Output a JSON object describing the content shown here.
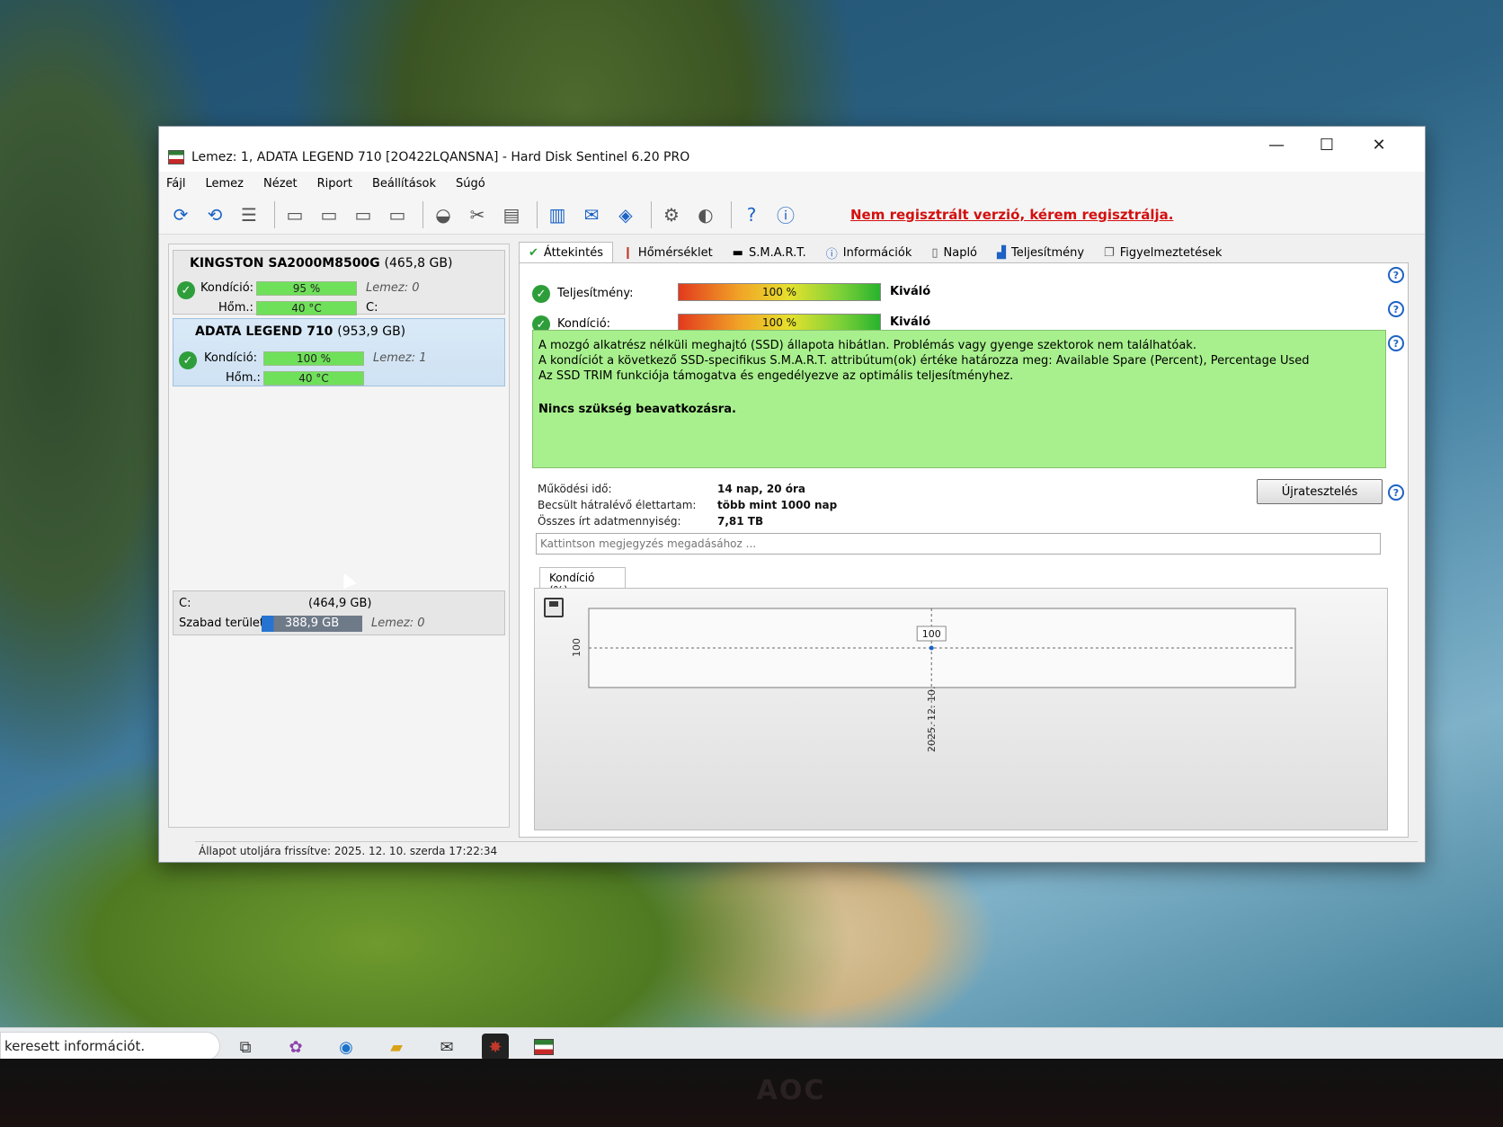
{
  "window": {
    "title": "Lemez: 1, ADATA LEGEND 710 [2O422LQANSNA]  -  Hard Disk Sentinel 6.20 PRO",
    "controls": {
      "minimize": "—",
      "maximize": "☐",
      "close": "✕"
    }
  },
  "menu": [
    "Fájl",
    "Lemez",
    "Nézet",
    "Riport",
    "Beállítások",
    "Súgó"
  ],
  "toolbar": {
    "registration_notice": "Nem regisztrált verzió, kérem regisztrálja."
  },
  "disks": [
    {
      "name": "KINGSTON SA2000M8500G",
      "size": "(465,8 GB)",
      "condition_label": "Kondíció:",
      "condition": "95 %",
      "condition_value": 95,
      "temp_label": "Hőm.:",
      "temp": "40 °C",
      "disk_ref": "Lemez: 0",
      "drive_letter": "C:"
    },
    {
      "name": "ADATA LEGEND 710",
      "size": "(953,9 GB)",
      "condition_label": "Kondíció:",
      "condition": "100 %",
      "condition_value": 100,
      "temp_label": "Hőm.:",
      "temp": "40 °C",
      "disk_ref": "Lemez: 1"
    }
  ],
  "volume": {
    "letter": "C:",
    "size": "(464,9 GB)",
    "free_label": "Szabad terület",
    "free": "388,9 GB",
    "disk_ref": "Lemez: 0"
  },
  "tabs": [
    {
      "label": "Áttekintés",
      "icon": "check-icon"
    },
    {
      "label": "Hőmérséklet",
      "icon": "thermometer-icon"
    },
    {
      "label": "S.M.A.R.T.",
      "icon": "smart-icon"
    },
    {
      "label": "Információk",
      "icon": "info-icon"
    },
    {
      "label": "Napló",
      "icon": "log-icon"
    },
    {
      "label": "Teljesítmény",
      "icon": "performance-icon"
    },
    {
      "label": "Figyelmeztetések",
      "icon": "alerts-icon"
    }
  ],
  "overview": {
    "performance_label": "Teljesítmény:",
    "performance": "100 %",
    "performance_rating": "Kiváló",
    "condition_label": "Kondíció:",
    "condition": "100 %",
    "condition_rating": "Kiváló",
    "status_lines": [
      "A mozgó alkatrész nélküli meghajtó (SSD) állapota hibátlan. Problémás vagy gyenge szektorok nem találhatóak.",
      "A kondíciót a következő SSD-specifikus S.M.A.R.T. attribútum(ok) értéke határozza meg:  Available Spare (Percent), Percentage Used",
      "Az SSD TRIM funkciója támogatva és engedélyezve az optimális teljesítményhez."
    ],
    "status_action": "Nincs szükség beavatkozásra.",
    "uptime_label": "Működési idő:",
    "uptime": "14 nap, 20 óra",
    "lifetime_label": "Becsült hátralévő élettartam:",
    "lifetime": "több mint 1000 nap",
    "written_label": "Összes írt adatmennyiség:",
    "written": "7,81 TB",
    "retest_button": "Újratesztelés",
    "note_placeholder": "Kattintson megjegyzés megadásához ..."
  },
  "status_bar": "Állapot utoljára frissítve: 2025. 12. 10. szerda 17:22:34",
  "taskbar": {
    "search_text": "keresett információt."
  },
  "chart_data": {
    "type": "line",
    "tab_label": "Kondíció  (%)",
    "x": [
      "2025. 12. 10."
    ],
    "series": [
      {
        "values": [
          100
        ]
      }
    ],
    "y_tick": "100",
    "point_label": "100",
    "ylim": [
      0,
      200
    ],
    "grid": true
  }
}
